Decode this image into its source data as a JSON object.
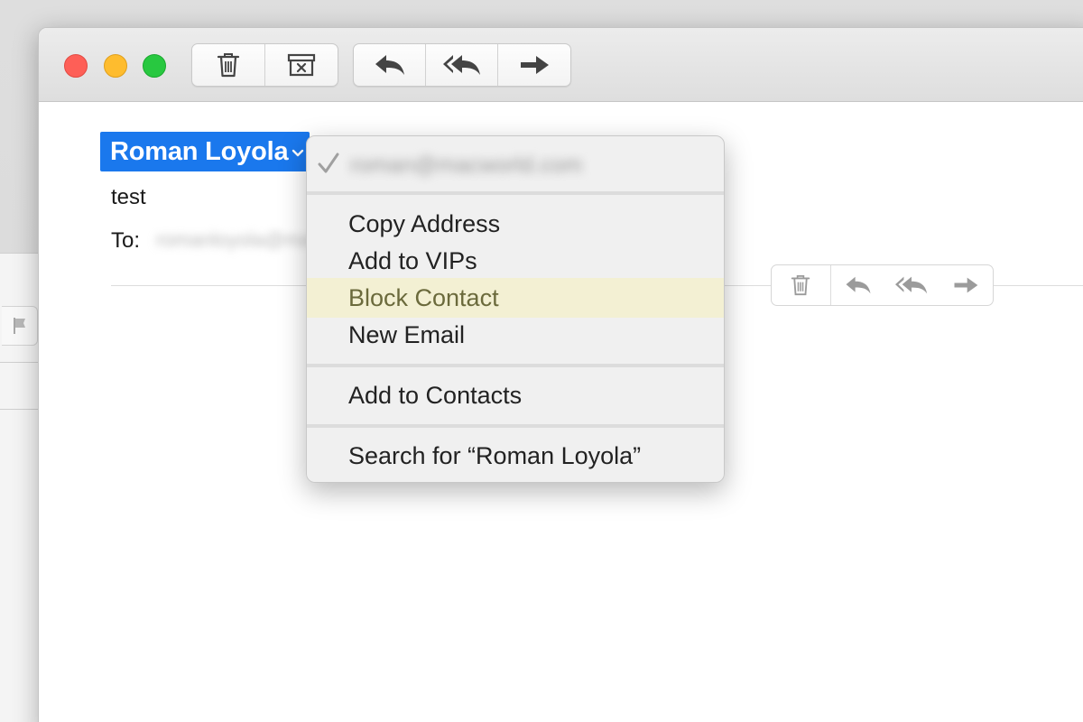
{
  "toolbar": {
    "trash_icon": "trash-icon",
    "junk_icon": "junk-box-icon",
    "reply_icon": "reply-icon",
    "reply_all_icon": "reply-all-icon",
    "forward_icon": "forward-icon"
  },
  "message": {
    "sender_name": "Roman Loyola",
    "subject": "test",
    "to_label": "To:",
    "to_value": "romanloyola@mac.com"
  },
  "context_menu": {
    "email_address": "roman@macworld.com",
    "items": [
      {
        "label": "Copy Address"
      },
      {
        "label": "Add to VIPs"
      },
      {
        "label": "Block Contact"
      },
      {
        "label": "New Email"
      },
      {
        "label": "Add to Contacts"
      },
      {
        "label": "Search for “Roman Loyola”"
      }
    ],
    "highlighted_item": "Block Contact"
  },
  "colors": {
    "sender_highlight": "#1a78ed",
    "menu_highlight": "#f3f0d3",
    "close": "#fe5f57",
    "minimize": "#febc2e",
    "zoom": "#28c840"
  }
}
